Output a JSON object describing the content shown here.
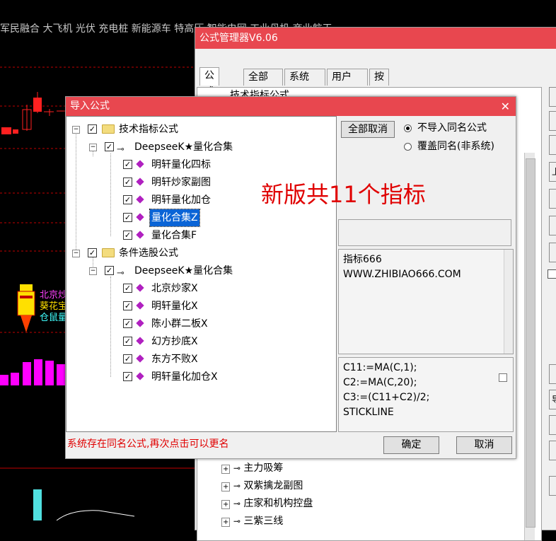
{
  "background": {
    "ticker_bar": "军民融合 大飞机 光伏 充电桩 新能源车 特高压 智能电网 工业母机 商业航天",
    "rocket_labels": [
      "北京炒",
      "葵花宝",
      "仓鼠量"
    ],
    "colors": {
      "grid_red": "#c00000",
      "bars_magenta": "#ff00ff",
      "bars_cyan": "#50e0e0",
      "rocket_yellow": "#ffe000"
    }
  },
  "manager": {
    "title": "公式管理器V6.06",
    "tabs": [
      "公式组",
      "全部",
      "系统",
      "用户",
      "按日期频度"
    ],
    "tree_top_item": "技术指标公式",
    "tree_items": [
      "主力吸筹",
      "双紫擒龙副图",
      "庄家和机构控盘",
      "三紫三线"
    ],
    "side_buttons": [
      "",
      "",
      "",
      "上",
      "",
      "",
      "",
      "",
      "导",
      "",
      "",
      ""
    ]
  },
  "dialog": {
    "title": "导入公式",
    "close_glyph": "✕",
    "groups": [
      {
        "label": "技术指标公式",
        "sub": "DeepseeK★量化合集",
        "items": [
          "明轩量化四标",
          "明轩炒家副图",
          "明轩量化加仓",
          "量化合集Z",
          "量化合集F"
        ],
        "selected_index": 3
      },
      {
        "label": "条件选股公式",
        "sub": "DeepseeK★量化合集",
        "items": [
          "北京炒家X",
          "明轩量化X",
          "陈小群二板X",
          "幻方抄底X",
          "东方不败X",
          "明轩量化加仓X"
        ]
      }
    ],
    "cancel_all_label": "全部取消",
    "radio_options": [
      "不导入同名公式",
      "覆盖同名(非系统)"
    ],
    "radio_selected": 0,
    "overlay_text": "新版共11个指标",
    "description": [
      "指标666",
      "WWW.ZHIBIAO666.COM"
    ],
    "code_lines": [
      "C11:=MA(C,1);",
      "C2:=MA(C,20);",
      "C3:=(C11+C2)/2;",
      "STICKLINE"
    ],
    "status_message": "系统存在同名公式,再次点击可以更名",
    "ok_label": "确定",
    "cancel_label": "取消",
    "colors": {
      "title_bar": "#e8474f",
      "status_text": "#e00000",
      "overlay_text": "#e00000",
      "selection": "#0a64d6"
    }
  }
}
